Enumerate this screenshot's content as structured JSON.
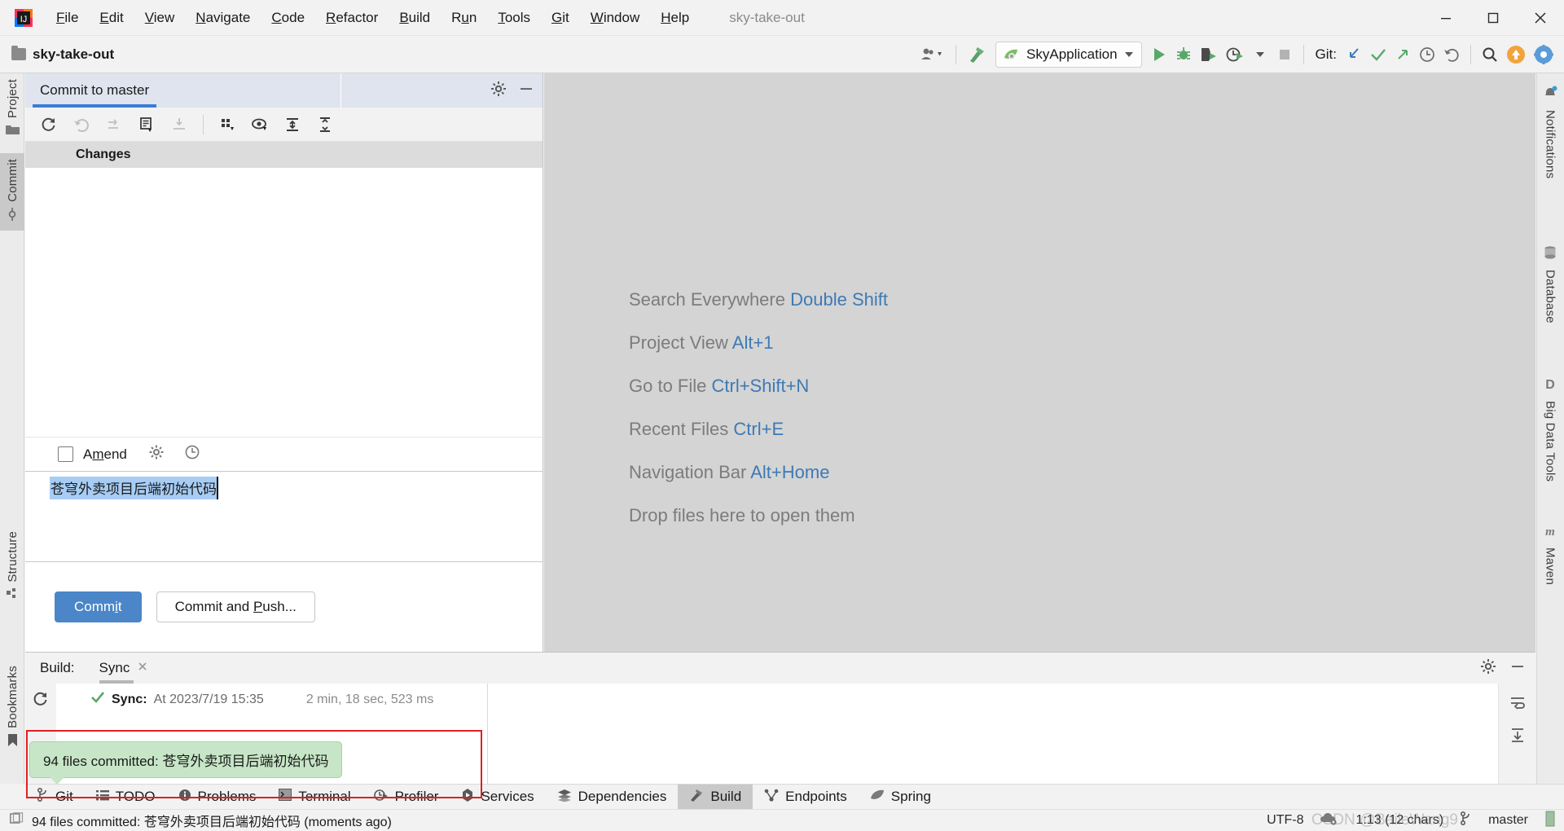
{
  "window": {
    "title": "sky-take-out",
    "logo_name": "intellij-idea-logo",
    "controls": {
      "minimize": "minimize",
      "maximize": "maximize",
      "close": "close"
    }
  },
  "menu": {
    "items": [
      {
        "label": "File",
        "mnemonic": "F"
      },
      {
        "label": "Edit",
        "mnemonic": "E"
      },
      {
        "label": "View",
        "mnemonic": "V"
      },
      {
        "label": "Navigate",
        "mnemonic": "N"
      },
      {
        "label": "Code",
        "mnemonic": "C"
      },
      {
        "label": "Refactor",
        "mnemonic": "R"
      },
      {
        "label": "Build",
        "mnemonic": "B"
      },
      {
        "label": "Run",
        "mnemonic": "u"
      },
      {
        "label": "Tools",
        "mnemonic": "T"
      },
      {
        "label": "Git",
        "mnemonic": "G"
      },
      {
        "label": "Window",
        "mnemonic": "W"
      },
      {
        "label": "Help",
        "mnemonic": "H"
      }
    ]
  },
  "navbar": {
    "project_name": "sky-take-out",
    "run_config": "SkyApplication",
    "git_label": "Git:",
    "actions": [
      "user-avatar-dropdown",
      "build-hammer",
      "run-button",
      "debug-button",
      "run-with-coverage",
      "profiler-button",
      "stop-button",
      "git-update-project",
      "git-commit-check",
      "git-push-arrow",
      "git-history-clock",
      "git-rollback",
      "search-everywhere",
      "notifications-updates",
      "ide-settings"
    ]
  },
  "left_stripe": {
    "tabs": [
      {
        "label": "Project",
        "icon": "folder-icon",
        "selected": false
      },
      {
        "label": "Commit",
        "icon": "commit-icon",
        "selected": true
      },
      {
        "label": "Structure",
        "icon": "structure-icon",
        "selected": false
      },
      {
        "label": "Bookmarks",
        "icon": "bookmark-icon",
        "selected": false
      }
    ]
  },
  "right_stripe": {
    "tabs": [
      {
        "label": "Notifications",
        "icon": "bell-icon"
      },
      {
        "label": "Database",
        "icon": "database-icon"
      },
      {
        "label": "Big Data Tools",
        "icon": "big-data-icon"
      },
      {
        "label": "Maven",
        "icon": "maven-icon"
      }
    ]
  },
  "commit_panel": {
    "tab_label": "Commit to master",
    "settings_icon": "gear-icon",
    "minimize_icon": "minimize-icon",
    "toolbar_actions": [
      "refresh-changes-icon",
      "rollback-icon",
      "shelve-silently-icon",
      "show-diff-icon",
      "get-from-vcs-icon",
      "group-by-icon",
      "preview-diff-icon",
      "expand-all-icon",
      "collapse-all-icon"
    ],
    "changes_header": "Changes",
    "amend_label": "Amend",
    "amend_checked": false,
    "amend_settings_icon": "gear-icon",
    "amend_history_icon": "clock-icon",
    "commit_message": "苍穹外卖项目后端初始代码",
    "commit_button": "Commit",
    "commit_push_button": "Commit and Push..."
  },
  "editor": {
    "hints": [
      {
        "action": "Search Everywhere",
        "shortcut": "Double Shift"
      },
      {
        "action": "Project View",
        "shortcut": "Alt+1"
      },
      {
        "action": "Go to File",
        "shortcut": "Ctrl+Shift+N"
      },
      {
        "action": "Recent Files",
        "shortcut": "Ctrl+E"
      },
      {
        "action": "Navigation Bar",
        "shortcut": "Alt+Home"
      },
      {
        "action": "Drop files here to open them",
        "shortcut": ""
      }
    ]
  },
  "build_panel": {
    "title": "Build:",
    "tab_label": "Sync",
    "tab_close_icon": "close-icon",
    "settings_icon": "gear-icon",
    "minimize_icon": "minimize-icon",
    "refresh_icon": "rerun-icon",
    "sync_status_icon": "success-check-icon",
    "sync_label": "Sync:",
    "sync_value": "At 2023/7/19 15:35",
    "sync_duration": "2 min, 18 sec, 523 ms",
    "console_actions": [
      "soft-wrap-icon",
      "scroll-to-end-icon"
    ]
  },
  "notification_balloon": {
    "text": "94 files committed: 苍穹外卖项目后端初始代码"
  },
  "bottom_tabs": [
    {
      "label": "Git",
      "icon": "git-branch-icon",
      "selected": false
    },
    {
      "label": "TODO",
      "icon": "todo-list-icon",
      "selected": false
    },
    {
      "label": "Problems",
      "icon": "problems-icon",
      "selected": false
    },
    {
      "label": "Terminal",
      "icon": "terminal-icon",
      "selected": false
    },
    {
      "label": "Profiler",
      "icon": "profiler-icon",
      "selected": false
    },
    {
      "label": "Services",
      "icon": "services-icon",
      "selected": false
    },
    {
      "label": "Dependencies",
      "icon": "dependencies-icon",
      "selected": false
    },
    {
      "label": "Build",
      "icon": "build-hammer-icon",
      "selected": true
    },
    {
      "label": "Endpoints",
      "icon": "endpoints-icon",
      "selected": false
    },
    {
      "label": "Spring",
      "icon": "spring-leaf-icon",
      "selected": false
    }
  ],
  "statusbar": {
    "message_icon": "event-log-icon",
    "message": "94 files committed: 苍穹外卖项目后端初始代码 (moments ago)",
    "encoding": "UTF-8",
    "encoding_icon": "cloud-settings-icon",
    "caret_position": "1:13 (12 chars)",
    "branch_icon": "git-branch-icon",
    "branch": "master"
  },
  "watermark": "CSDN @BaileWang9",
  "colors": {
    "accent_blue": "#3b7dd8",
    "button_blue": "#4a86c8",
    "hint_key_blue": "#3d7ab5",
    "balloon_green": "#c7e6c7",
    "success_green": "#59a869",
    "annotation_red": "#e02020",
    "selection_blue": "#a7cdf5"
  }
}
